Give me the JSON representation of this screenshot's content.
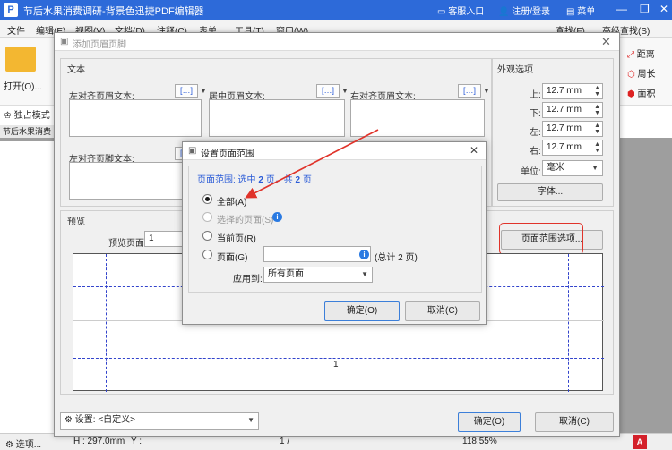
{
  "app": {
    "title": "节后水果消费调研-背景色迅捷PDF编辑器",
    "logo_glyph": "P",
    "customer_service": "客服入口",
    "login": "注册/登录",
    "menu": "菜单",
    "brand_color": "#2d6ad9"
  },
  "menubar": {
    "items": [
      "文件",
      "编辑(E)",
      "视图(V)",
      "文档(D)",
      "注释(C)",
      "表单",
      "工具(T)",
      "窗口(W)"
    ],
    "find_label": "查找(F)",
    "advanced_find": "高级查找(S)"
  },
  "toolbar": {
    "open_label": "打开(O)...",
    "exclusive_mode": "独占模式",
    "right_tools": [
      "距离",
      "周长",
      "面积"
    ]
  },
  "doc_tab": "节后水果消费",
  "statusbar": {
    "options": "选项...",
    "height": "H : 297.0mm",
    "y_label": "Y :",
    "page_indicator": "1 /",
    "zoom": "118.55%"
  },
  "header_footer_dialog": {
    "title": "添加页眉页脚",
    "text_group": "文本",
    "left_header": "左对齐页眉文本:",
    "center_header": "居中页眉文本:",
    "right_header": "右对齐页眉文本:",
    "left_footer": "左对齐页脚文本:",
    "macro_glyph": "[…]",
    "appearance_group": "外观选项",
    "margins": [
      {
        "label": "上:",
        "value": "12.7 mm"
      },
      {
        "label": "下:",
        "value": "12.7 mm"
      },
      {
        "label": "左:",
        "value": "12.7 mm"
      },
      {
        "label": "右:",
        "value": "12.7 mm"
      }
    ],
    "unit_label": "单位:",
    "unit_value": "毫米",
    "font_button": "字体...",
    "preview_group": "预览",
    "preview_page_label": "预览页面",
    "preview_page_value": "1",
    "page_range_button": "页面范围选项...",
    "preview_page_number": "1",
    "settings_label": "设置:",
    "settings_value": "<自定义>",
    "ok": "确定(O)",
    "cancel": "取消(C)"
  },
  "page_range_dialog": {
    "title": "设置页面范围",
    "summary_prefix": "页面范围: 选中",
    "summary_selected": "2",
    "summary_mid": "页，共",
    "summary_total": "2",
    "summary_suffix": "页",
    "option_all": "全部(A)",
    "option_selected": "选择的页面(S)",
    "option_current": "当前页(R)",
    "option_pages": "页面(G)",
    "pages_total": "(总计 2 页)",
    "apply_to_label": "应用到:",
    "apply_to_value": "所有页面",
    "ok": "确定(O)",
    "cancel": "取消(C)"
  },
  "annotation_color": "#e0332a"
}
